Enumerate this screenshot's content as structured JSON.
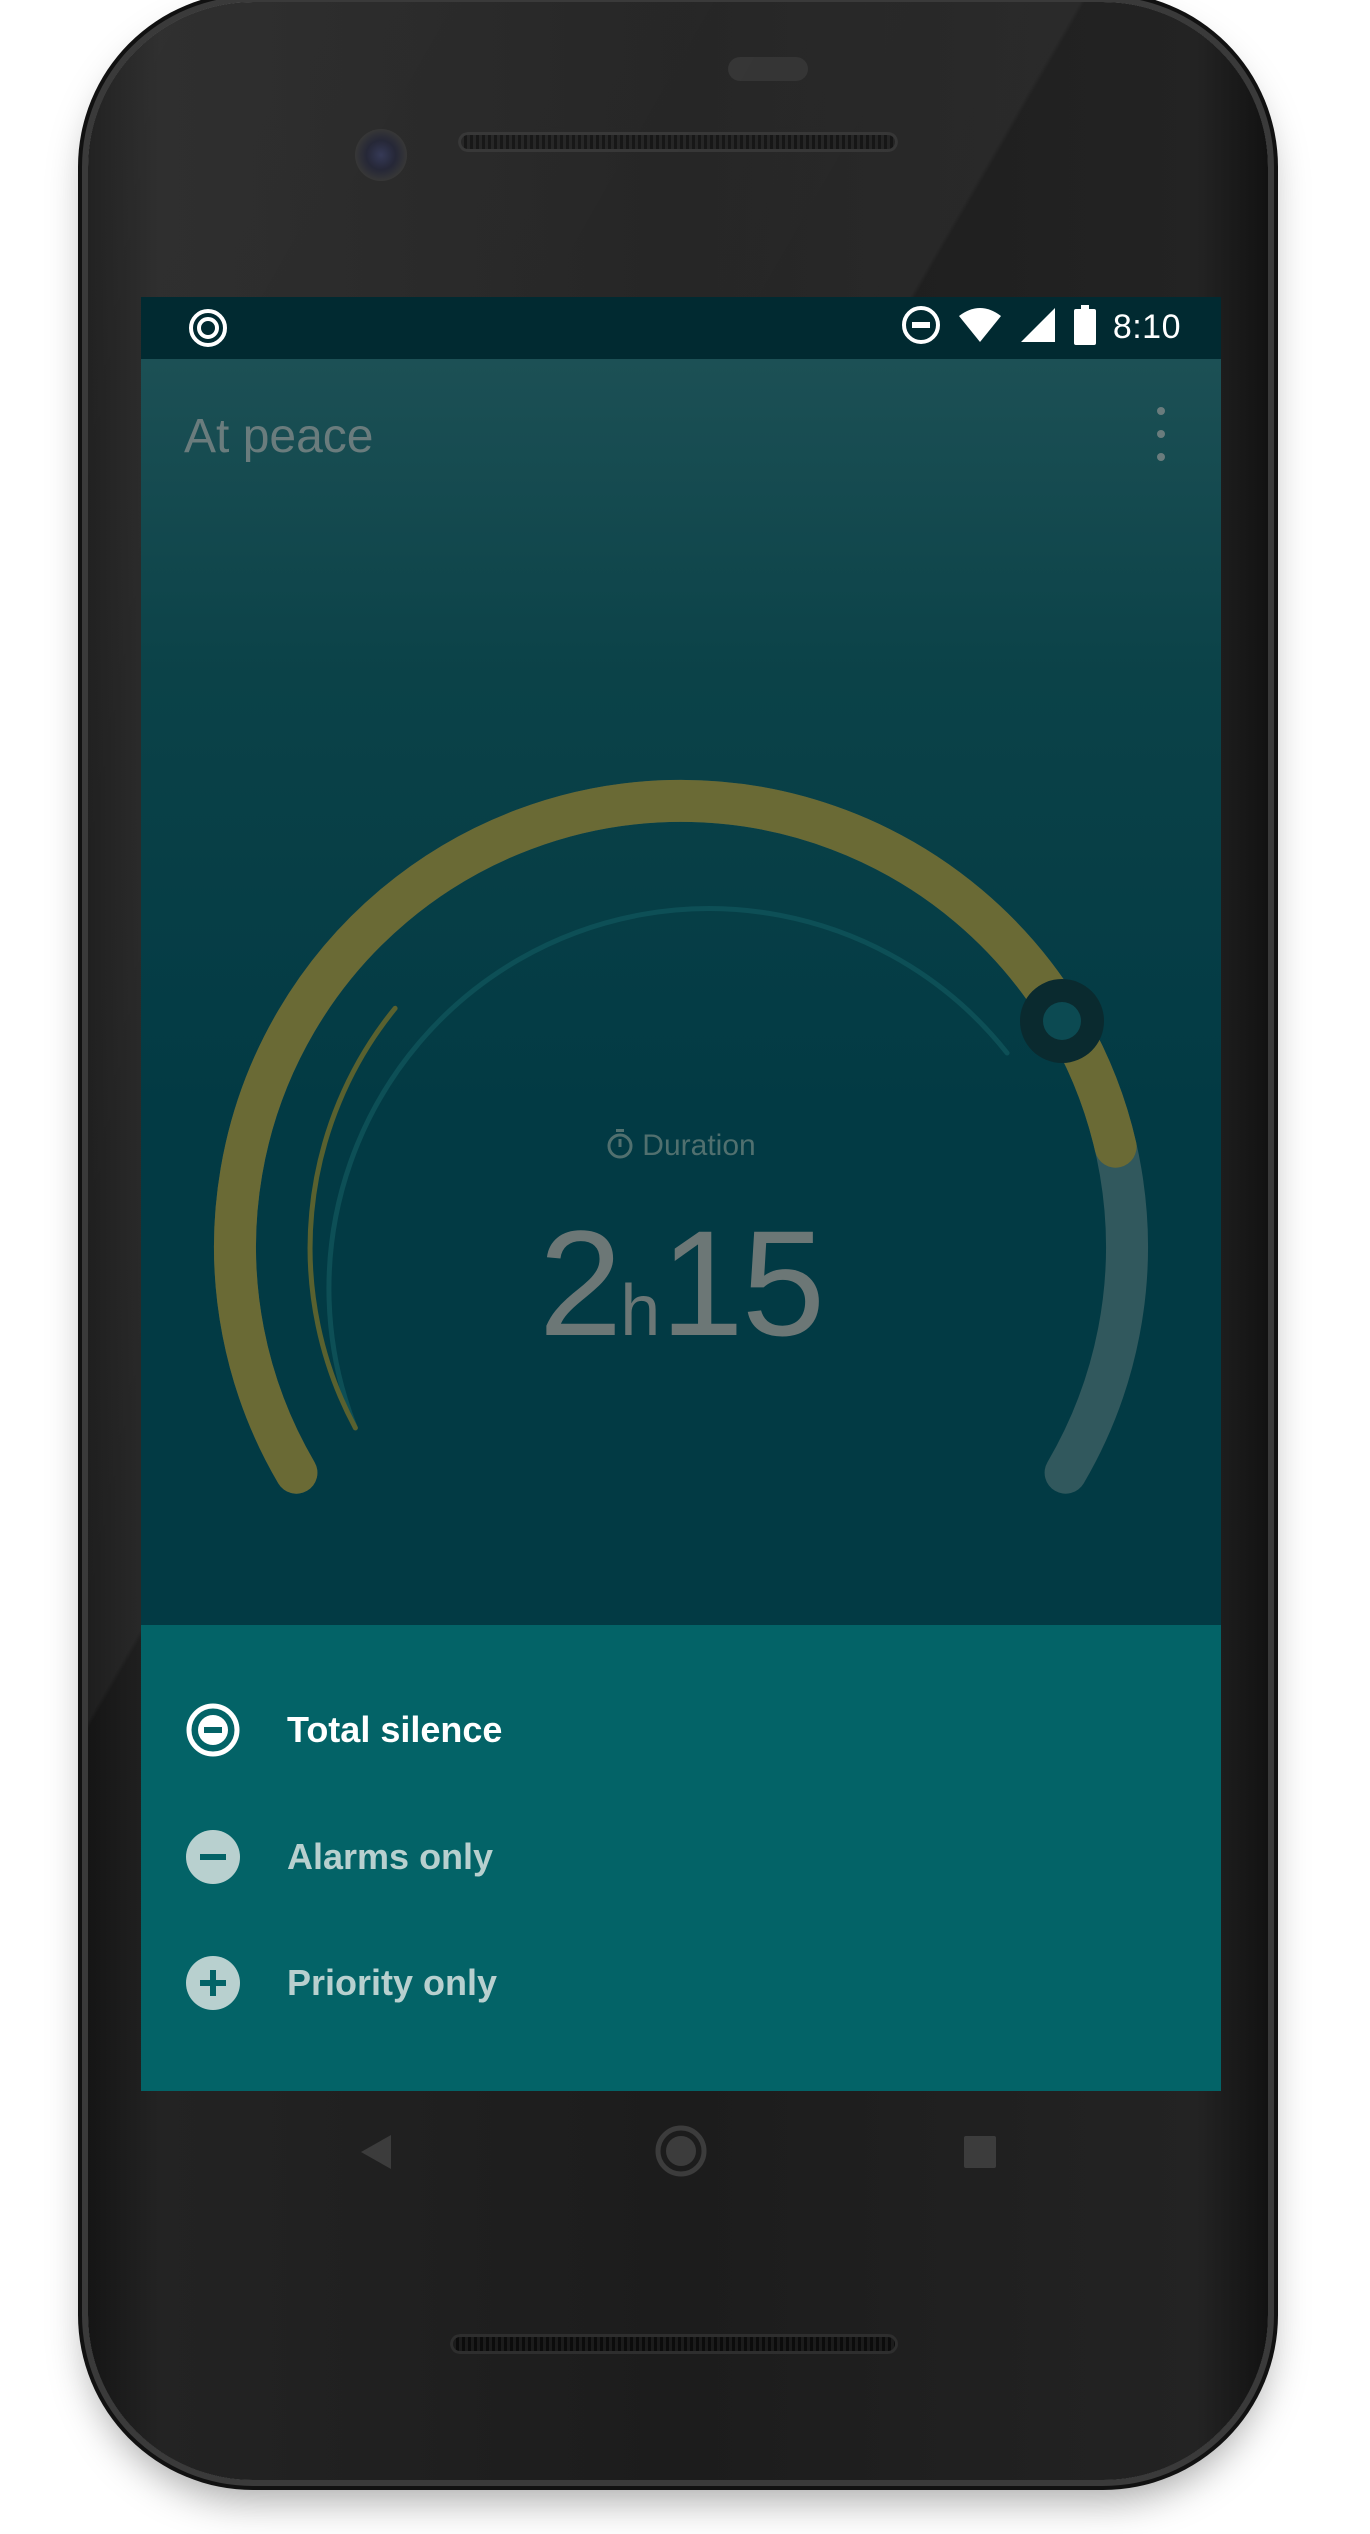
{
  "status_bar": {
    "time": "8:10",
    "left_icon": "dnd-ring-icon",
    "right_icons": [
      "do-not-disturb-icon",
      "wifi-icon",
      "cellular-signal-icon",
      "battery-icon"
    ]
  },
  "app_bar": {
    "title": "At peace",
    "menu_icon": "more-vert-icon"
  },
  "timer": {
    "label": "Duration",
    "label_icon": "stopwatch-icon",
    "hours": "2",
    "hours_unit": "h",
    "minutes": "15",
    "progress_fraction": 0.82
  },
  "modes": [
    {
      "label": "Total silence",
      "icon": "do-not-disturb-icon",
      "selected": true
    },
    {
      "label": "Alarms only",
      "icon": "minus-circle-icon",
      "selected": false
    },
    {
      "label": "Priority only",
      "icon": "plus-circle-icon",
      "selected": false
    }
  ],
  "navigation": {
    "back_icon": "back-triangle-icon",
    "home_icon": "home-circle-icon",
    "recents_icon": "recents-square-icon"
  },
  "colors": {
    "screen_bg": "#023a44",
    "dial_active": "#6a6a35",
    "dial_track": "#31585d",
    "panel_bg": "#036367",
    "mode_selected_text": "#ffffff",
    "mode_text": "#b8d0cf"
  }
}
